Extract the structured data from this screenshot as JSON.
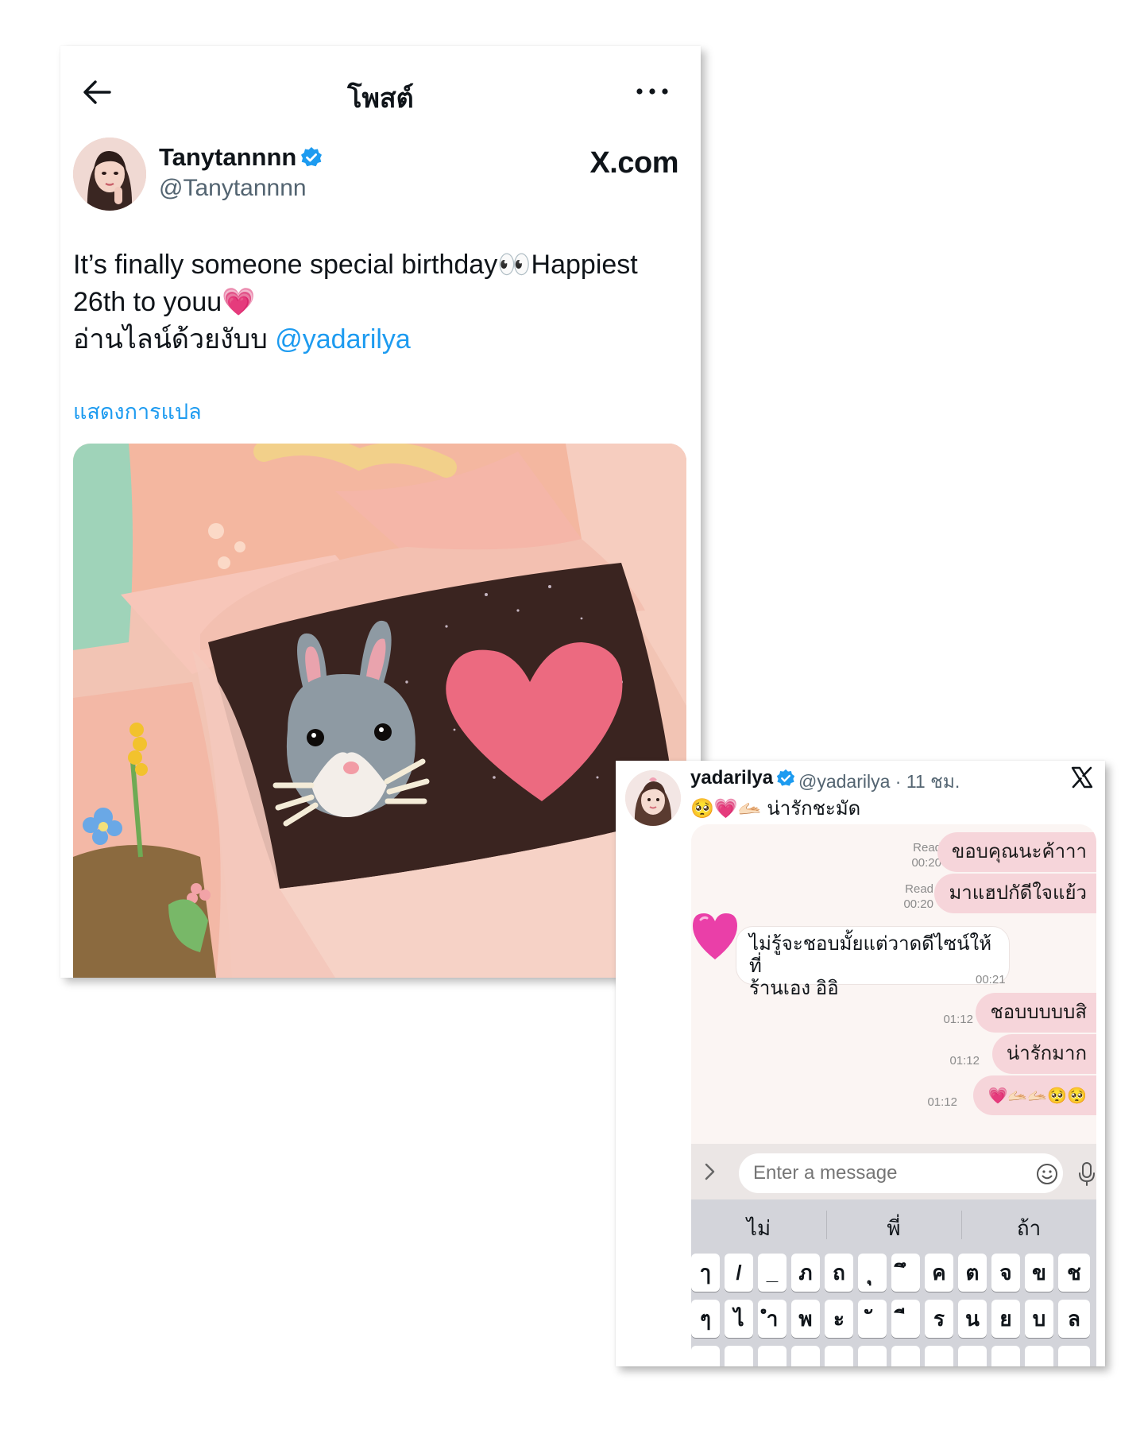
{
  "post": {
    "header_title": "โพสต์",
    "author_name": "Tanytannnn",
    "author_handle": "@Tanytannnn",
    "source_logo": "X.com",
    "text_line1": "It’s finally someone special birthday👀Happiest",
    "text_line2": "26th to youu💗",
    "text_line3_thai": " อ่านไลน์ด้วยงับบ ",
    "mention": "@yadarilya",
    "translate_label": "แสดงการแปล",
    "icons": [
      "back-arrow-icon",
      "more-icon",
      "verified-icon"
    ],
    "accent_color": "#1d9bf0"
  },
  "reply": {
    "name": "yadarilya",
    "meta": "@yadarilya · 11 ชม.",
    "emoji": "🥺💗🫴🏻",
    "text": "น่ารักชะมัด"
  },
  "chat": {
    "messages": [
      {
        "dir": "out",
        "text": "ขอบคุณนะค้าาา",
        "status": "Read",
        "time": "00:20"
      },
      {
        "dir": "out",
        "text": "มาแฮปกัดีใจแย้ว",
        "status": "Read",
        "time": "00:20"
      },
      {
        "dir": "in",
        "text_line1": "ไม่รู้จะชอบมั้ยแต่วาดดีไซน์ให้ที่",
        "text_line2": "ร้านเอง อิอิ",
        "time": "00:21"
      },
      {
        "dir": "out",
        "text": "ชอบบบบบสิ",
        "time": "01:12"
      },
      {
        "dir": "out",
        "text": "น่ารักมาก",
        "time": "01:12"
      },
      {
        "dir": "out",
        "text": "💗🫴🏻🫴🏻🥺🥺",
        "time": "01:12"
      }
    ],
    "input_placeholder": "Enter a message",
    "bubble_color": "#f6d5da"
  },
  "keyboard": {
    "suggestions": [
      "ไม่",
      "พี่",
      "ถ้า"
    ],
    "row1": [
      "ๅ",
      "/",
      "_",
      "ภ",
      "ถ",
      "ุ",
      "ึ",
      "ค",
      "ต",
      "จ",
      "ข",
      "ช"
    ],
    "row2": [
      "ๆ",
      "ไ",
      "ำ",
      "พ",
      "ะ",
      "ั",
      "ี",
      "ร",
      "น",
      "ย",
      "บ",
      "ล"
    ]
  }
}
